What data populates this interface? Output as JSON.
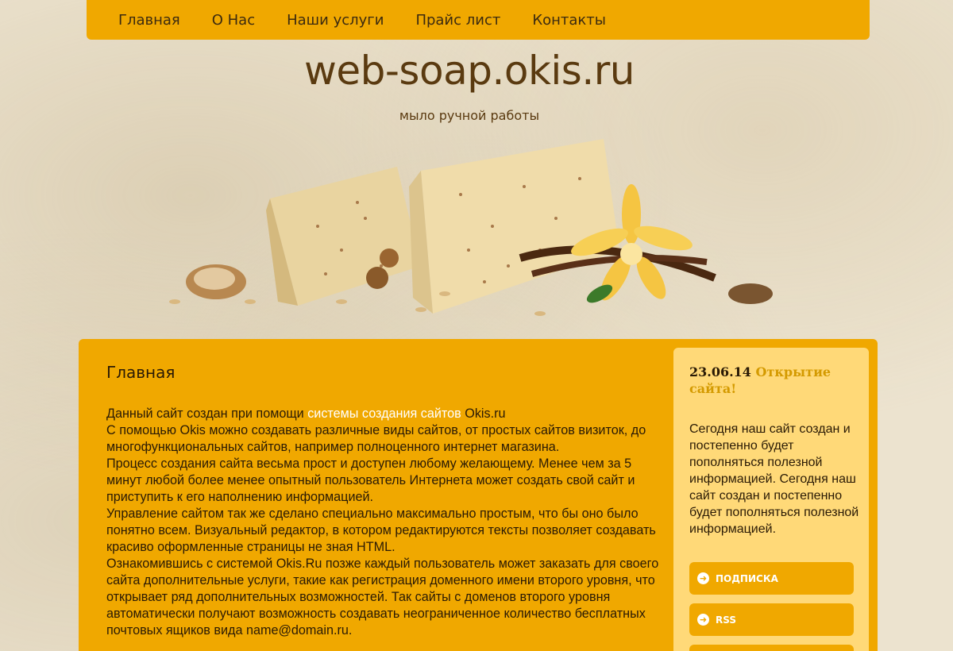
{
  "nav": {
    "items": [
      "Главная",
      "О Нас",
      "Наши услуги",
      "Прайс лист",
      "Контакты"
    ]
  },
  "header": {
    "title": "web-soap.okis.ru",
    "subtitle": "мыло ручной работы"
  },
  "content": {
    "heading": "Главная",
    "p1_before": "Данный сайт создан при помощи ",
    "p1_link": "системы создания сайтов",
    "p1_after": " Okis.ru",
    "p2": "С помощью Okis можно создавать различные виды сайтов, от простых сайтов визиток, до многофункциональных сайтов, например полноценного интернет магазина.",
    "p3": "Процесс создания сайта весьма прост и доступен любому желающему. Менее чем за 5 минут любой более менее опытный пользователь Интернета может создать свой сайт и приступить к его наполнению информацией.",
    "p4": "Управление сайтом так же сделано специально максимально простым, что бы оно было понятно всем. Визуальный редактор, в котором редактируются тексты позволяет создавать красиво оформленные страницы не зная HTML.",
    "p5": "Ознакомившись с системой Okis.Ru позже каждый пользователь может заказать для своего сайта дополнительные услуги, такие как регистрация доменного имени второго уровня, что открывает ряд дополнительных возможностей. Так сайты с доменов второго уровня автоматически получают возможность создавать неограниченное количество бесплатных почтовых ящиков вида name@domain.ru."
  },
  "sidebar": {
    "news_date": "23.06.14",
    "news_title": "Открытие сайта!",
    "news_body": "Сегодня наш сайт создан и постепенно будет пополняться полезной информацией. Сегодня наш сайт создан и постепенно будет пополняться полезной информацией.",
    "buttons": [
      "ПОДПИСКА",
      "RSS"
    ]
  },
  "colors": {
    "accent": "#f0a800",
    "sidebar_bg": "#ffd978",
    "text_dark": "#2a1a05",
    "title_brown": "#5a3a10"
  }
}
